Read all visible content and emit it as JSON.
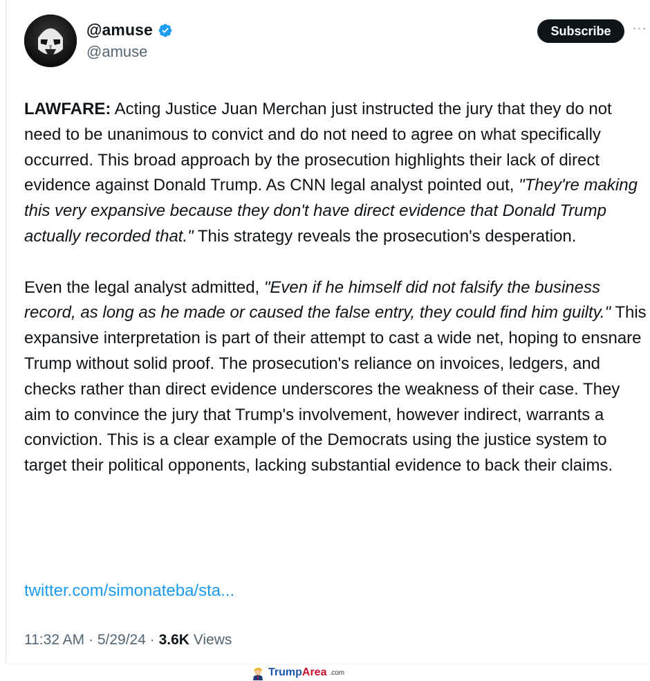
{
  "author": {
    "display_name": "@amuse",
    "handle": "@amuse",
    "verified_icon": "verified-badge-icon",
    "avatar_icon": "stormtrooper-avatar"
  },
  "actions": {
    "subscribe_label": "Subscribe",
    "more_label": "···"
  },
  "tweet": {
    "p1_lead": "LAWFARE:",
    "p1_a": " Acting Justice Juan Merchan just instructed the jury that they do not need to be unanimous to convict and do not need to agree on what specifically occurred. This broad approach by the prosecution highlights their lack of direct evidence against Donald Trump. As CNN legal analyst pointed out, ",
    "p1_quote": "\"They're making this very expansive because they don't have direct evidence that Donald Trump actually recorded that.\"",
    "p1_b": " This strategy reveals the prosecution's desperation.",
    "p2_a": "Even the legal analyst admitted, ",
    "p2_quote": "\"Even if he himself did not falsify the business record, as long as he made or caused the false entry, they could find him guilty.\"",
    "p2_b": " This expansive interpretation is part of their attempt to cast a wide net, hoping to ensnare Trump without solid proof. The prosecution's reliance on invoices, ledgers, and checks rather than direct evidence underscores the weakness of their case. They aim to convince the jury that Trump's involvement, however indirect, warrants a conviction. This is a clear example of the Democrats using the justice system to target their political opponents, lacking substantial evidence to back their claims.",
    "link": "twitter.com/simonateba/sta..."
  },
  "meta": {
    "time": "11:32 AM",
    "sep1": " · ",
    "date": "5/29/24",
    "sep2": " · ",
    "views_count": "3.6K",
    "views_label": " Views"
  },
  "watermark": {
    "part1": "Trump",
    "part2": "Area",
    "suffix": ".com"
  },
  "colors": {
    "link": "#1d9bf0",
    "verified": "#1d9bf0",
    "subscribe_bg": "#0f1419",
    "secondary_text": "#536471"
  }
}
